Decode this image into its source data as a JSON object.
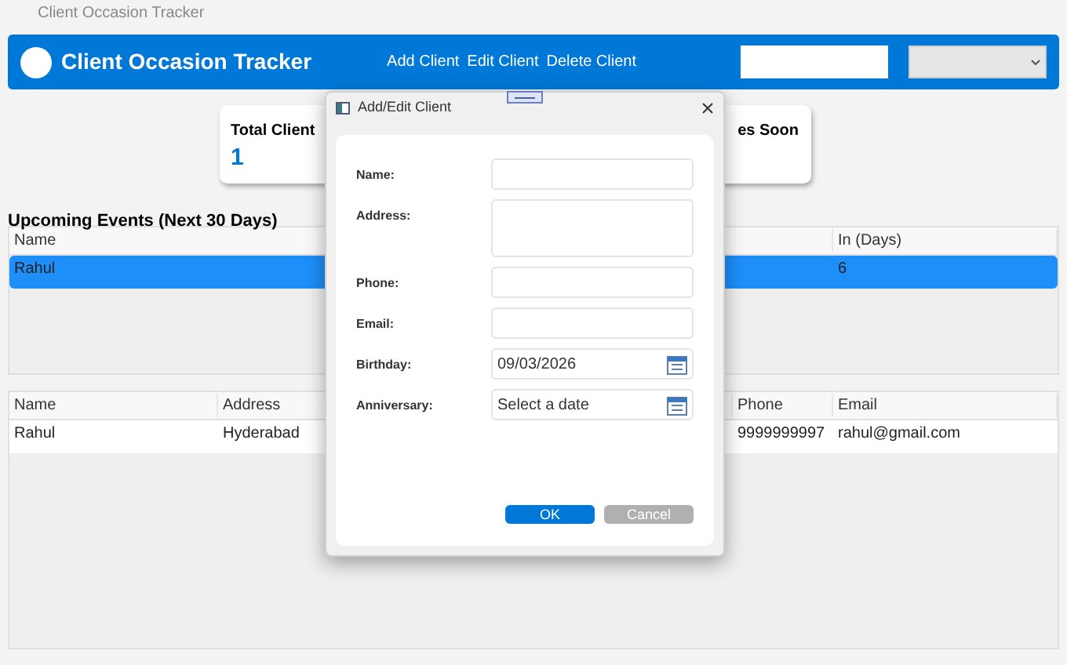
{
  "window": {
    "title": "Client Occasion Tracker"
  },
  "header": {
    "title": "Client Occasion Tracker",
    "nav": [
      "Add Client",
      "Edit Client",
      "Delete Client"
    ]
  },
  "cards": [
    {
      "label": "Total Client",
      "value": "1"
    },
    {
      "label": "es Soon"
    }
  ],
  "upcoming": {
    "title": "Upcoming Events (Next 30 Days)",
    "columns": [
      "Name",
      "In (Days)"
    ],
    "rows": [
      {
        "cells": [
          "Rahul",
          "6"
        ],
        "selected": true
      }
    ]
  },
  "clients": {
    "columns": [
      "Name",
      "Address",
      "Phone",
      "Email"
    ],
    "rows": [
      {
        "cells": [
          "Rahul",
          "Hyderabad",
          "9999999997",
          "rahul@gmail.com"
        ],
        "selected": false
      }
    ]
  },
  "dialog": {
    "title": "Add/Edit Client",
    "fields": [
      {
        "kind": "text",
        "label": "Name:"
      },
      {
        "kind": "multiline",
        "label": "Address:"
      },
      {
        "kind": "text",
        "label": "Phone:"
      },
      {
        "kind": "text",
        "label": "Email:"
      },
      {
        "kind": "date",
        "label": "Birthday:",
        "value": "09/03/2026"
      },
      {
        "kind": "date",
        "label": "Anniversary:",
        "placeholder": "Select a date"
      }
    ],
    "buttons": [
      {
        "label": "OK",
        "kind": "primary"
      },
      {
        "label": "Cancel",
        "kind": "secondary"
      }
    ]
  }
}
